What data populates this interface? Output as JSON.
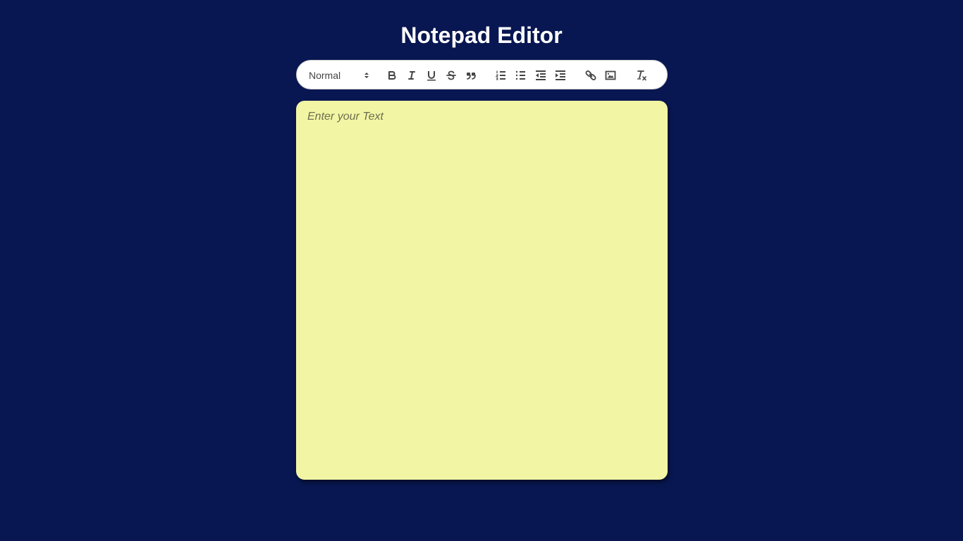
{
  "page": {
    "title": "Notepad Editor"
  },
  "toolbar": {
    "header_select": {
      "selected": "Normal"
    },
    "buttons": [
      {
        "name": "bold",
        "icon": "bold-icon"
      },
      {
        "name": "italic",
        "icon": "italic-icon"
      },
      {
        "name": "underline",
        "icon": "underline-icon"
      },
      {
        "name": "strike",
        "icon": "strikethrough-icon"
      },
      {
        "name": "blockquote",
        "icon": "quote-icon"
      },
      {
        "name": "ordered-list",
        "icon": "ordered-list-icon"
      },
      {
        "name": "bullet-list",
        "icon": "bullet-list-icon"
      },
      {
        "name": "outdent",
        "icon": "outdent-icon"
      },
      {
        "name": "indent",
        "icon": "indent-icon"
      },
      {
        "name": "link",
        "icon": "link-icon"
      },
      {
        "name": "image",
        "icon": "image-icon"
      },
      {
        "name": "clean",
        "icon": "clear-format-icon"
      }
    ]
  },
  "editor": {
    "placeholder": "Enter your Text",
    "value": ""
  },
  "colors": {
    "background": "#081751",
    "editor_background": "#f2f5a3",
    "toolbar_background": "#ffffff",
    "icon": "#444444",
    "title": "#ffffff"
  }
}
